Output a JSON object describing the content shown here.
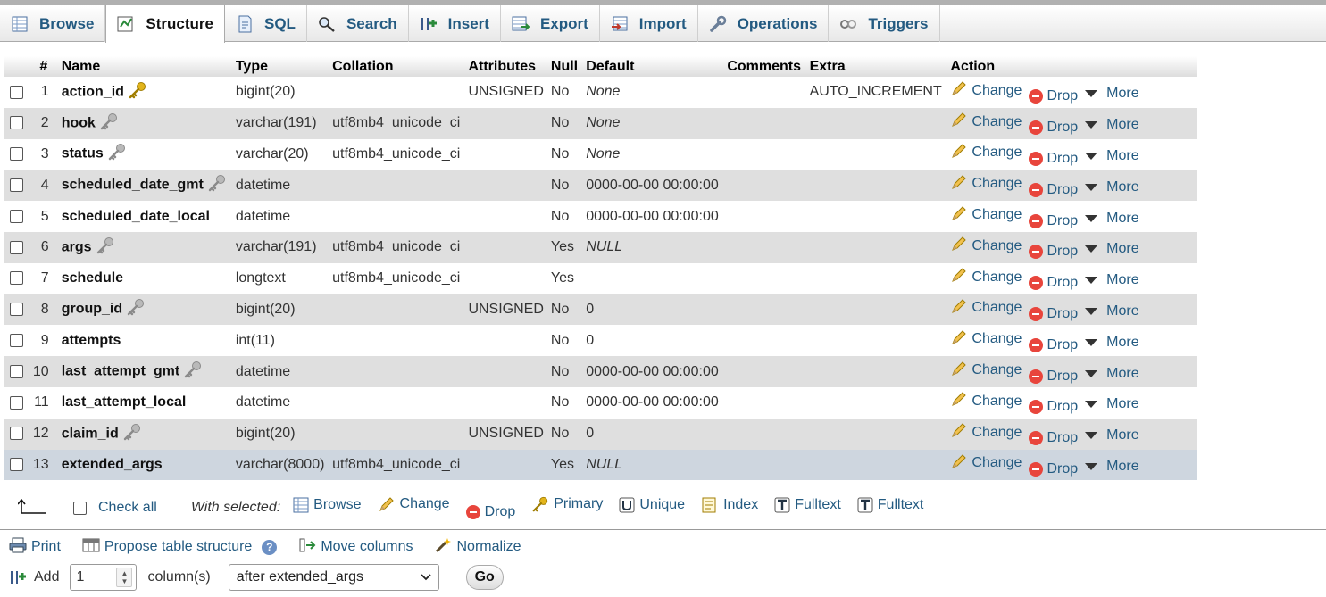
{
  "tabs": [
    {
      "label": "Browse",
      "icon": "browse-icon"
    },
    {
      "label": "Structure",
      "icon": "structure-icon"
    },
    {
      "label": "SQL",
      "icon": "sql-icon"
    },
    {
      "label": "Search",
      "icon": "search-icon"
    },
    {
      "label": "Insert",
      "icon": "insert-icon"
    },
    {
      "label": "Export",
      "icon": "export-icon"
    },
    {
      "label": "Import",
      "icon": "import-icon"
    },
    {
      "label": "Operations",
      "icon": "wrench-icon"
    },
    {
      "label": "Triggers",
      "icon": "triggers-icon"
    }
  ],
  "columns": [
    "#",
    "Name",
    "Type",
    "Collation",
    "Attributes",
    "Null",
    "Default",
    "Comments",
    "Extra",
    "Action"
  ],
  "rows": [
    {
      "n": "1",
      "name": "action_id",
      "key": "primary",
      "type": "bigint(20)",
      "collation": "",
      "attr": "UNSIGNED",
      "null": "No",
      "default": "None",
      "def_italic": true,
      "extra": "AUTO_INCREMENT"
    },
    {
      "n": "2",
      "name": "hook",
      "key": "index",
      "type": "varchar(191)",
      "collation": "utf8mb4_unicode_ci",
      "attr": "",
      "null": "No",
      "default": "None",
      "def_italic": true,
      "extra": ""
    },
    {
      "n": "3",
      "name": "status",
      "key": "index",
      "type": "varchar(20)",
      "collation": "utf8mb4_unicode_ci",
      "attr": "",
      "null": "No",
      "default": "None",
      "def_italic": true,
      "extra": ""
    },
    {
      "n": "4",
      "name": "scheduled_date_gmt",
      "key": "index",
      "type": "datetime",
      "collation": "",
      "attr": "",
      "null": "No",
      "default": "0000-00-00 00:00:00",
      "def_italic": false,
      "extra": ""
    },
    {
      "n": "5",
      "name": "scheduled_date_local",
      "key": "",
      "type": "datetime",
      "collation": "",
      "attr": "",
      "null": "No",
      "default": "0000-00-00 00:00:00",
      "def_italic": false,
      "extra": ""
    },
    {
      "n": "6",
      "name": "args",
      "key": "index",
      "type": "varchar(191)",
      "collation": "utf8mb4_unicode_ci",
      "attr": "",
      "null": "Yes",
      "default": "NULL",
      "def_italic": true,
      "extra": ""
    },
    {
      "n": "7",
      "name": "schedule",
      "key": "",
      "type": "longtext",
      "collation": "utf8mb4_unicode_ci",
      "attr": "",
      "null": "Yes",
      "default": "",
      "def_italic": false,
      "extra": ""
    },
    {
      "n": "8",
      "name": "group_id",
      "key": "index",
      "type": "bigint(20)",
      "collation": "",
      "attr": "UNSIGNED",
      "null": "No",
      "default": "0",
      "def_italic": false,
      "extra": ""
    },
    {
      "n": "9",
      "name": "attempts",
      "key": "",
      "type": "int(11)",
      "collation": "",
      "attr": "",
      "null": "No",
      "default": "0",
      "def_italic": false,
      "extra": ""
    },
    {
      "n": "10",
      "name": "last_attempt_gmt",
      "key": "index",
      "type": "datetime",
      "collation": "",
      "attr": "",
      "null": "No",
      "default": "0000-00-00 00:00:00",
      "def_italic": false,
      "extra": ""
    },
    {
      "n": "11",
      "name": "last_attempt_local",
      "key": "",
      "type": "datetime",
      "collation": "",
      "attr": "",
      "null": "No",
      "default": "0000-00-00 00:00:00",
      "def_italic": false,
      "extra": ""
    },
    {
      "n": "12",
      "name": "claim_id",
      "key": "index",
      "type": "bigint(20)",
      "collation": "",
      "attr": "UNSIGNED",
      "null": "No",
      "default": "0",
      "def_italic": false,
      "extra": ""
    },
    {
      "n": "13",
      "name": "extended_args",
      "key": "",
      "type": "varchar(8000)",
      "collation": "utf8mb4_unicode_ci",
      "attr": "",
      "null": "Yes",
      "default": "NULL",
      "def_italic": true,
      "extra": ""
    }
  ],
  "row_actions": {
    "change": "Change",
    "drop": "Drop",
    "more": "More"
  },
  "bulk": {
    "check_all": "Check all",
    "with_selected": "With selected:",
    "actions": [
      "Browse",
      "Change",
      "Drop",
      "Primary",
      "Unique",
      "Index",
      "Fulltext",
      "Fulltext"
    ]
  },
  "tools": {
    "print": "Print",
    "propose": "Propose table structure",
    "move": "Move columns",
    "normalize": "Normalize"
  },
  "add": {
    "label": "Add",
    "count": "1",
    "unit": "column(s)",
    "position": "after extended_args",
    "go": "Go"
  },
  "colors": {
    "link": "#235a81",
    "row_even": "#dfdfdf",
    "row_highlight": "#ced6df",
    "drop_icon": "#e8453c",
    "key_primary": "#e2b41b",
    "key_index": "#9a9a9a"
  }
}
